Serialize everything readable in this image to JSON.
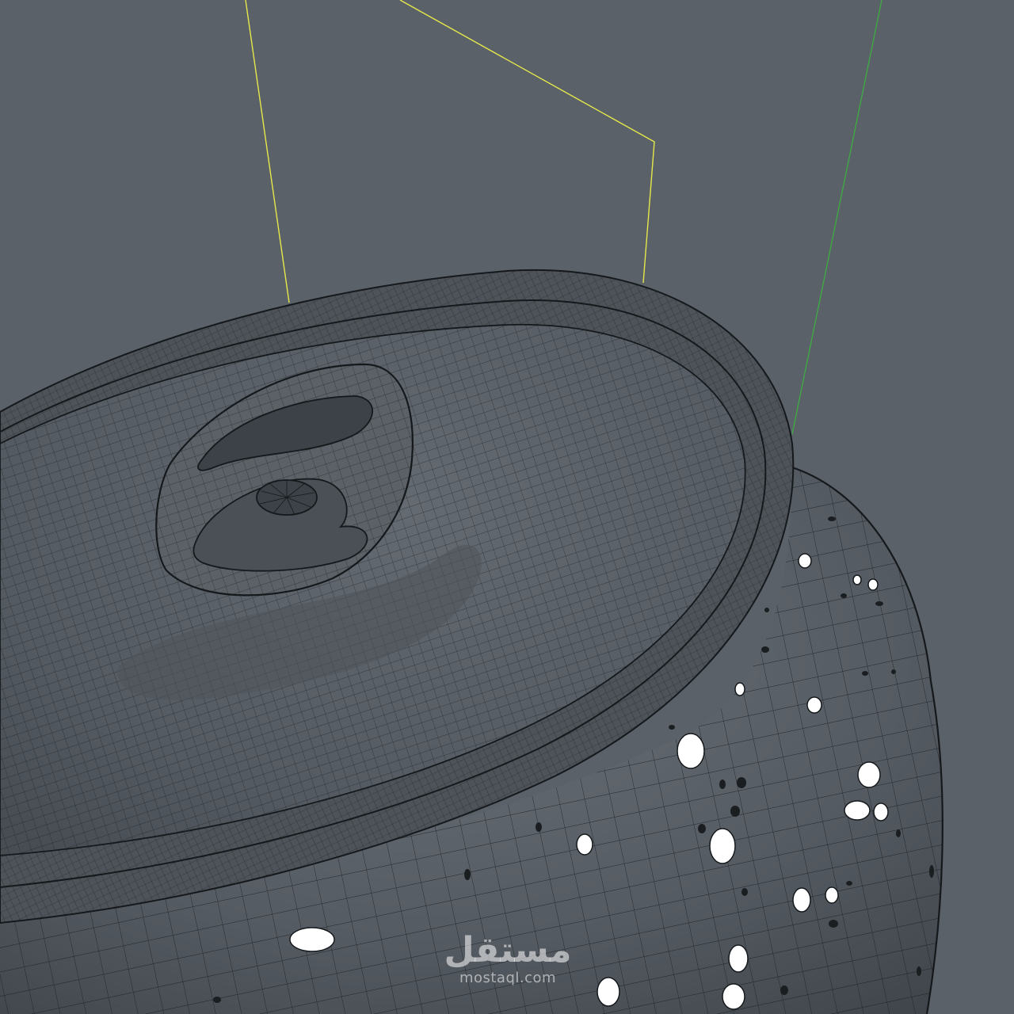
{
  "viewport": {
    "background_color": "#5a6169",
    "mesh_color": "#5b6167",
    "wire_color": "#15191c",
    "droplet_color": "#ffffff",
    "guide_primary_color": "#e6e84a",
    "guide_secondary_color": "#3fa845"
  },
  "watermark": {
    "arabic": "مستقل",
    "latin": "mostaql.com"
  }
}
